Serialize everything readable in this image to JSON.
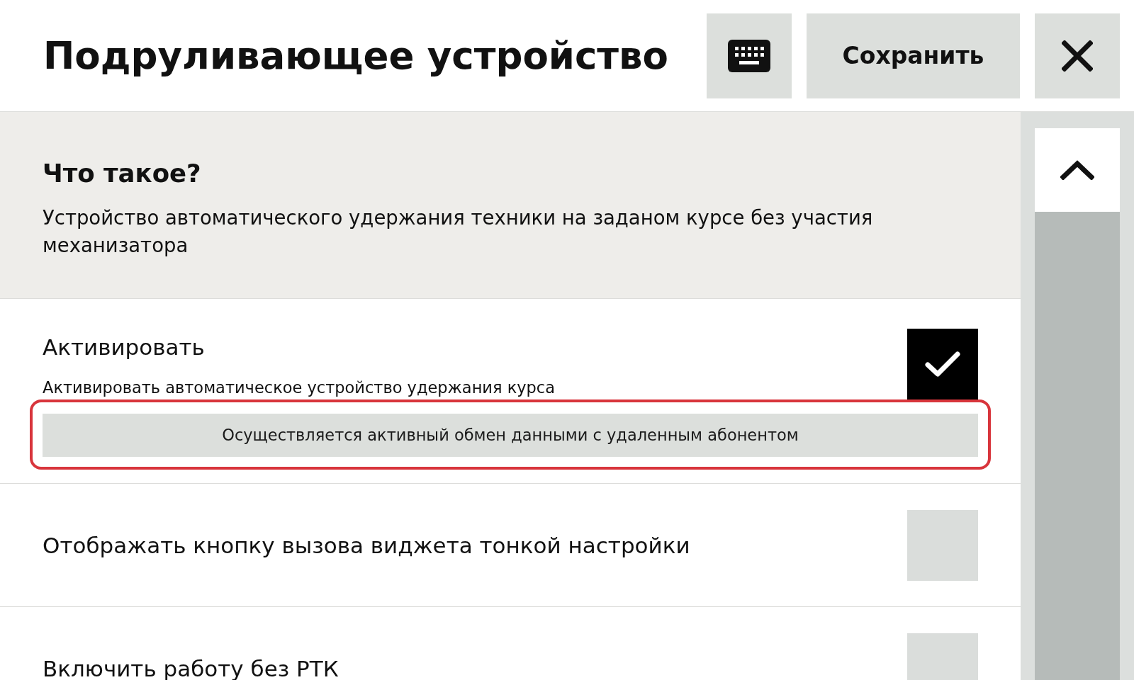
{
  "header": {
    "title": "Подруливающее устройство",
    "buttons": [
      {
        "kind": "keyboard"
      },
      {
        "kind": "save",
        "label": "Сохранить"
      },
      {
        "kind": "close"
      }
    ]
  },
  "info": {
    "title": "Что такое?",
    "text": "Устройство автоматического удержания техники на заданом курсе без участия механизатора"
  },
  "settings": [
    {
      "label": "Активировать",
      "description": "Активировать автоматическое устройство удержания курса",
      "checked": true,
      "status": {
        "text": "Осуществляется активный обмен данными с удаленным абонентом",
        "highlighted": true
      }
    },
    {
      "label": "Отображать кнопку вызова виджета тонкой настройки",
      "checked": false
    },
    {
      "label": "Включить работу без РТК",
      "checked": false
    }
  ]
}
